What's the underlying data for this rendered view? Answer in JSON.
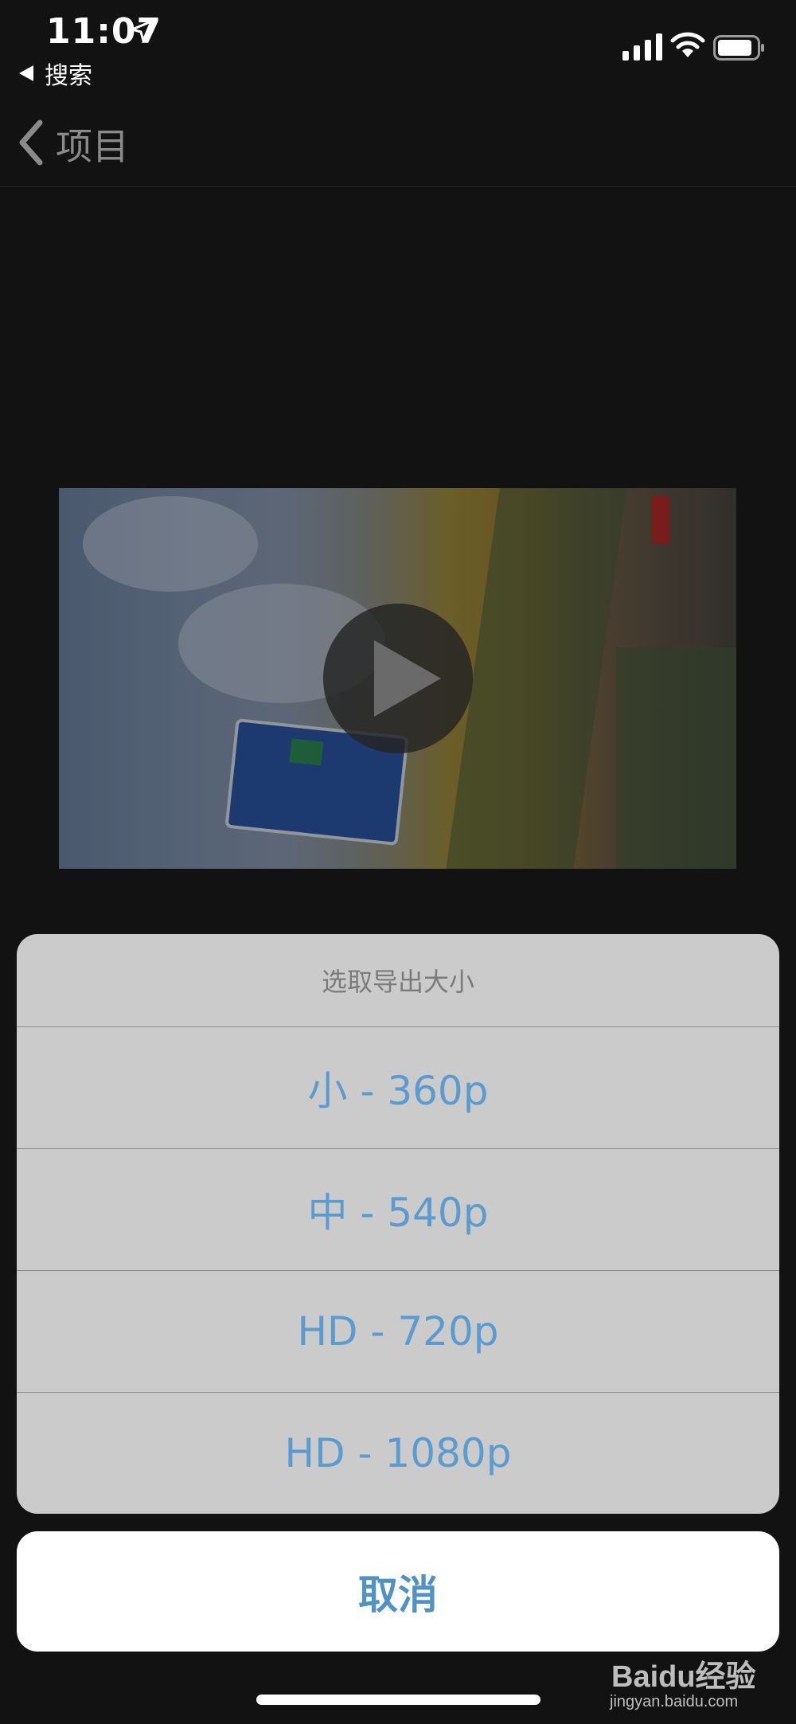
{
  "status_bar": {
    "time": "11:07",
    "back_app_label": "搜索"
  },
  "nav": {
    "back_label": "项目"
  },
  "video": {
    "play_icon": "play-icon"
  },
  "action_sheet": {
    "title": "选取导出大小",
    "options": [
      {
        "label": "小 - 360p"
      },
      {
        "label": "中 - 540p"
      },
      {
        "label": "HD - 720p"
      },
      {
        "label": "HD - 1080p"
      }
    ],
    "cancel_label": "取消"
  },
  "watermark": {
    "brand": "Baidu经验",
    "site": "jingyan.baidu.com"
  },
  "colors": {
    "background": "#121212",
    "sheet": "#cbcbcb",
    "option_text": "#5b9bd0",
    "cancel_text": "#4f92c6"
  }
}
